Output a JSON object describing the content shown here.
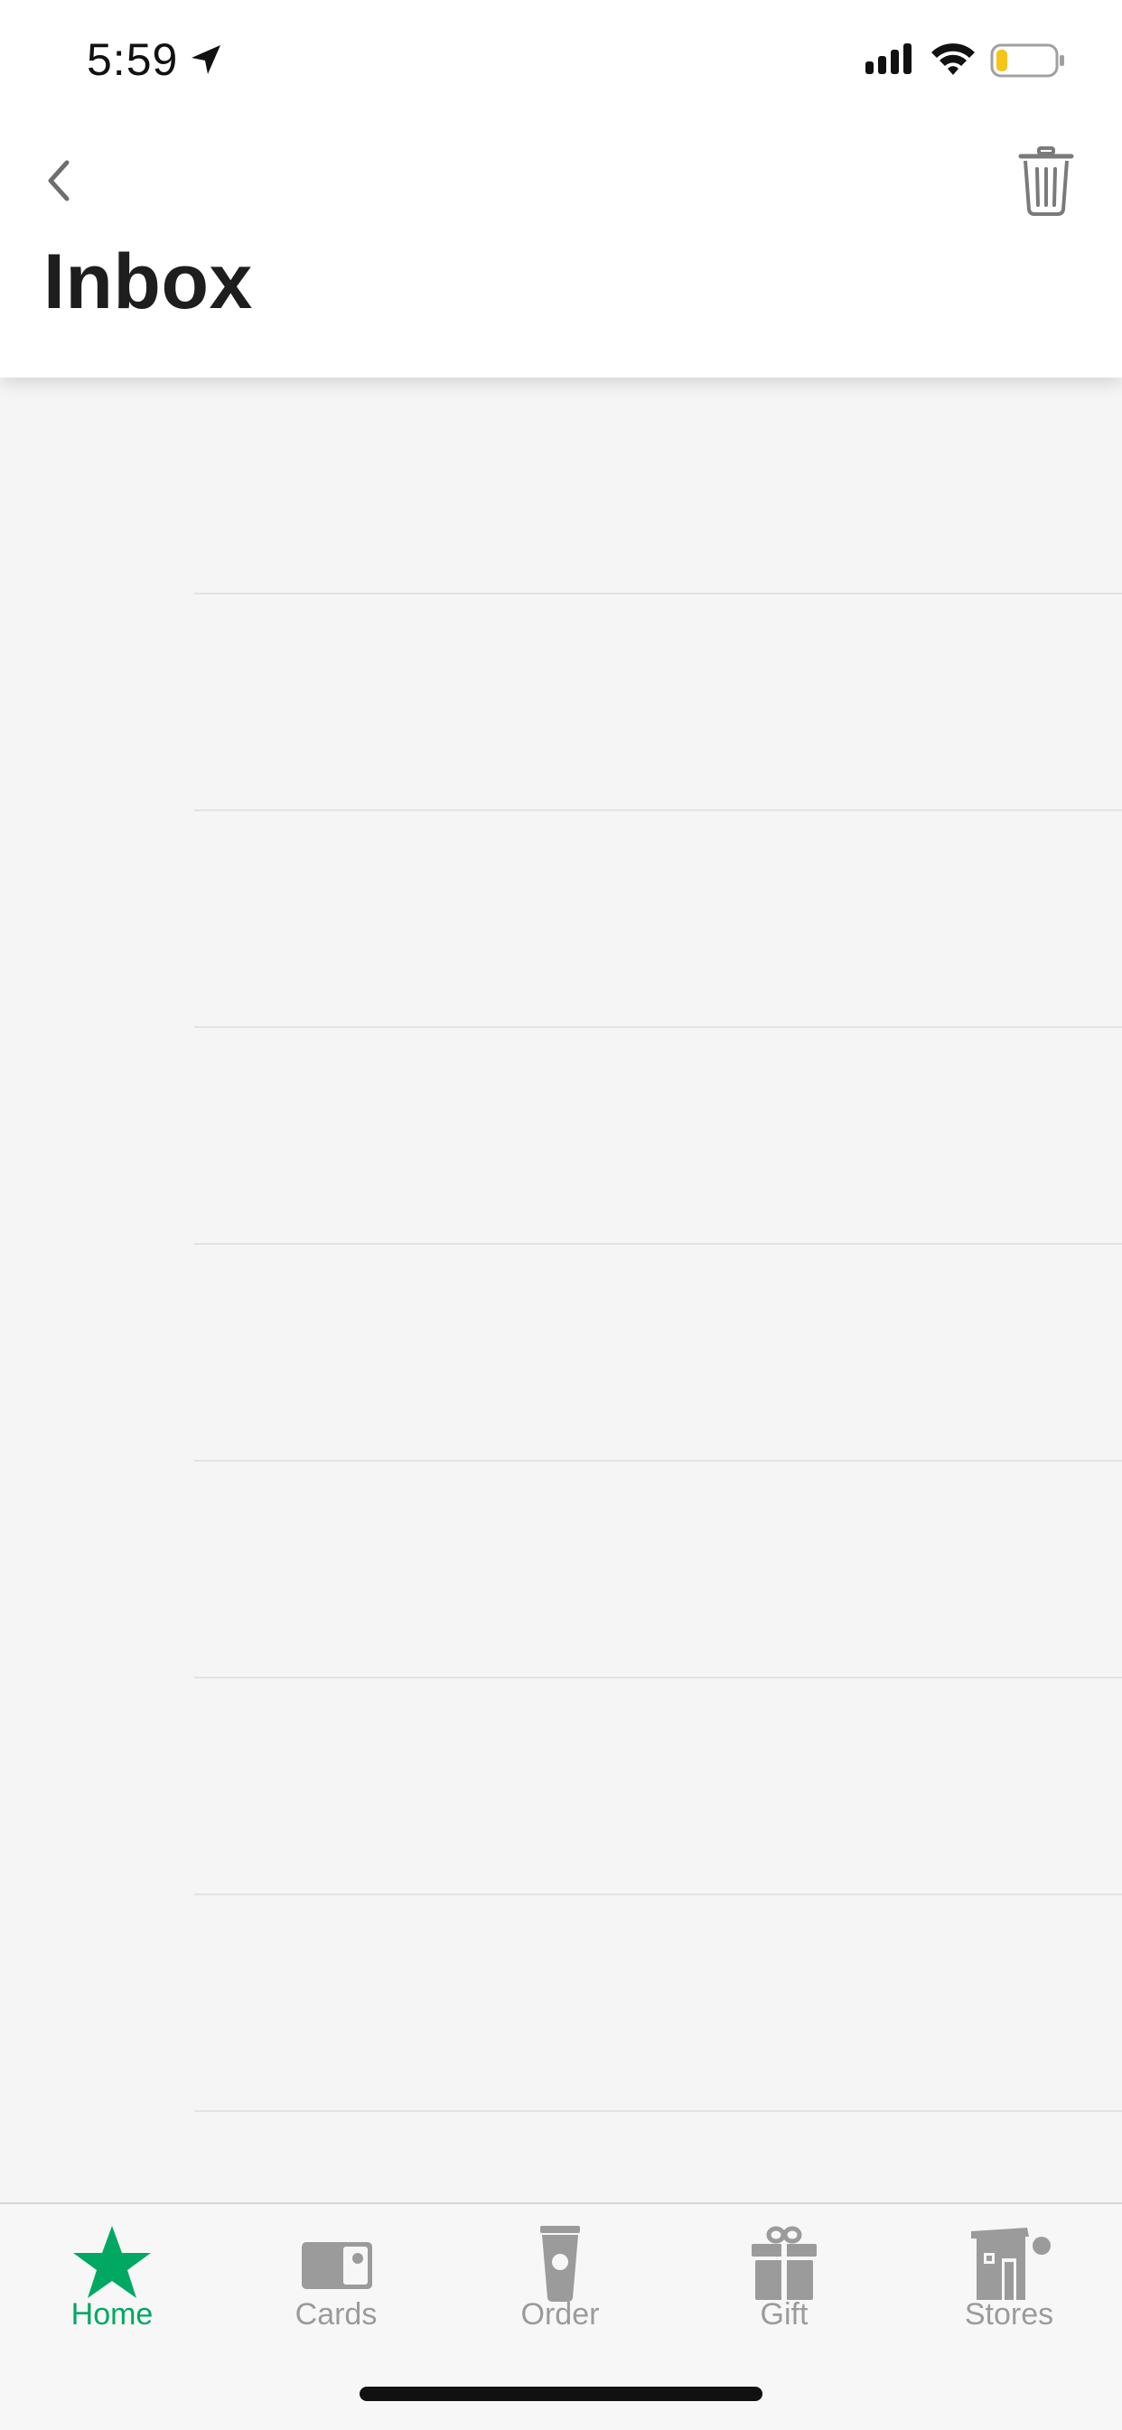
{
  "status_bar": {
    "time": "5:59",
    "icons": [
      "location-arrow-icon",
      "cellular-signal-icon",
      "wifi-icon",
      "battery-low-icon"
    ]
  },
  "header": {
    "title": "Inbox",
    "back_icon": "chevron-left-icon",
    "trash_icon": "trash-icon"
  },
  "inbox": {
    "messages": []
  },
  "tab_bar": {
    "tabs": [
      {
        "label": "Home",
        "icon": "star-icon",
        "active": true
      },
      {
        "label": "Cards",
        "icon": "card-icon",
        "active": false
      },
      {
        "label": "Order",
        "icon": "cup-icon",
        "active": false
      },
      {
        "label": "Gift",
        "icon": "gift-icon",
        "active": false
      },
      {
        "label": "Stores",
        "icon": "store-icon",
        "active": false
      }
    ]
  },
  "colors": {
    "accent": "#00a862",
    "inactive": "#9b9b9b",
    "background": "#f5f5f5",
    "battery_level": "#f5c518"
  }
}
